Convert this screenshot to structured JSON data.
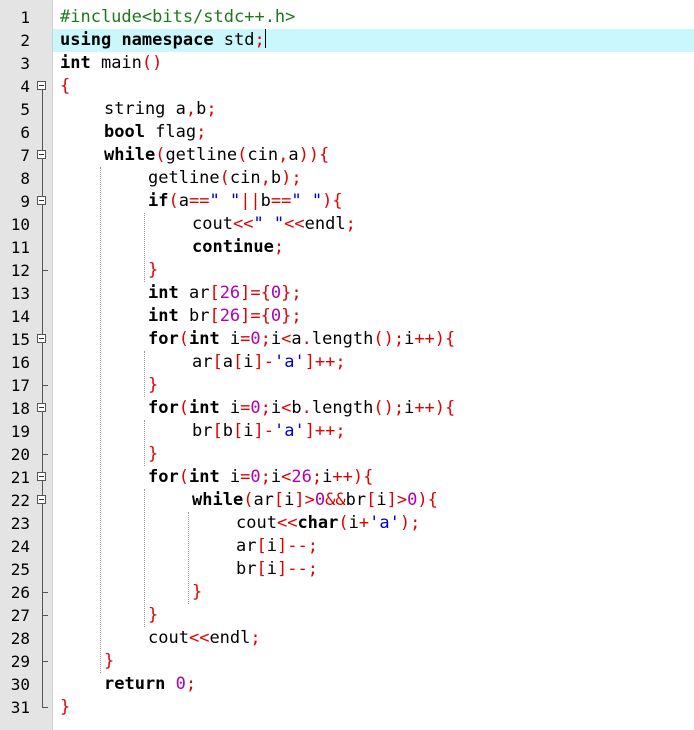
{
  "editor": {
    "current_line": 2,
    "colors": {
      "keyword": "#000000",
      "operator": "#e00000",
      "number": "#b000b0",
      "string": "#0000cc",
      "preprocessor": "#1a7a1a",
      "current_line_bg": "#c9f7fb"
    },
    "lines": [
      {
        "n": "1",
        "fold": "none",
        "indent": 0,
        "tokens": [
          [
            "pp",
            "#include<bits/stdc++.h>"
          ]
        ]
      },
      {
        "n": "2",
        "fold": "none",
        "indent": 0,
        "tokens": [
          [
            "kw",
            "using"
          ],
          [
            "txt",
            " "
          ],
          [
            "kw",
            "namespace"
          ],
          [
            "txt",
            " std"
          ],
          [
            "op",
            ";"
          ]
        ],
        "caret": true
      },
      {
        "n": "3",
        "fold": "none",
        "indent": 0,
        "tokens": [
          [
            "kw",
            "int"
          ],
          [
            "txt",
            " main"
          ],
          [
            "op",
            "()"
          ]
        ]
      },
      {
        "n": "4",
        "fold": "open",
        "indent": 0,
        "tokens": [
          [
            "op",
            "{"
          ]
        ]
      },
      {
        "n": "5",
        "fold": "line",
        "indent": 1,
        "tokens": [
          [
            "txt",
            "string a"
          ],
          [
            "op",
            ","
          ],
          [
            "txt",
            "b"
          ],
          [
            "op",
            ";"
          ]
        ]
      },
      {
        "n": "6",
        "fold": "line",
        "indent": 1,
        "tokens": [
          [
            "kw",
            "bool"
          ],
          [
            "txt",
            " flag"
          ],
          [
            "op",
            ";"
          ]
        ]
      },
      {
        "n": "7",
        "fold": "open",
        "indent": 1,
        "tokens": [
          [
            "kw",
            "while"
          ],
          [
            "op",
            "("
          ],
          [
            "txt",
            "getline"
          ],
          [
            "op",
            "("
          ],
          [
            "txt",
            "cin"
          ],
          [
            "op",
            ","
          ],
          [
            "txt",
            "a"
          ],
          [
            "op",
            "))"
          ],
          [
            "op",
            "{"
          ]
        ]
      },
      {
        "n": "8",
        "fold": "line",
        "indent": 2,
        "tokens": [
          [
            "txt",
            "getline"
          ],
          [
            "op",
            "("
          ],
          [
            "txt",
            "cin"
          ],
          [
            "op",
            ","
          ],
          [
            "txt",
            "b"
          ],
          [
            "op",
            ");"
          ]
        ]
      },
      {
        "n": "9",
        "fold": "open",
        "indent": 2,
        "tokens": [
          [
            "kw",
            "if"
          ],
          [
            "op",
            "("
          ],
          [
            "txt",
            "a"
          ],
          [
            "op",
            "=="
          ],
          [
            "str",
            "\" \""
          ],
          [
            "op",
            "||"
          ],
          [
            "txt",
            "b"
          ],
          [
            "op",
            "=="
          ],
          [
            "str",
            "\" \""
          ],
          [
            "op",
            "){"
          ]
        ]
      },
      {
        "n": "10",
        "fold": "line",
        "indent": 3,
        "tokens": [
          [
            "txt",
            "cout"
          ],
          [
            "op",
            "<<"
          ],
          [
            "str",
            "\" \""
          ],
          [
            "op",
            "<<"
          ],
          [
            "txt",
            "endl"
          ],
          [
            "op",
            ";"
          ]
        ]
      },
      {
        "n": "11",
        "fold": "line",
        "indent": 3,
        "tokens": [
          [
            "kw",
            "continue"
          ],
          [
            "op",
            ";"
          ]
        ]
      },
      {
        "n": "12",
        "fold": "end",
        "indent": 2,
        "tokens": [
          [
            "op",
            "}"
          ]
        ]
      },
      {
        "n": "13",
        "fold": "line",
        "indent": 2,
        "tokens": [
          [
            "kw",
            "int"
          ],
          [
            "txt",
            " ar"
          ],
          [
            "op",
            "["
          ],
          [
            "num",
            "26"
          ],
          [
            "op",
            "]={"
          ],
          [
            "num",
            "0"
          ],
          [
            "op",
            "};"
          ]
        ]
      },
      {
        "n": "14",
        "fold": "line",
        "indent": 2,
        "tokens": [
          [
            "kw",
            "int"
          ],
          [
            "txt",
            " br"
          ],
          [
            "op",
            "["
          ],
          [
            "num",
            "26"
          ],
          [
            "op",
            "]={"
          ],
          [
            "num",
            "0"
          ],
          [
            "op",
            "};"
          ]
        ]
      },
      {
        "n": "15",
        "fold": "open",
        "indent": 2,
        "tokens": [
          [
            "kw",
            "for"
          ],
          [
            "op",
            "("
          ],
          [
            "kw",
            "int"
          ],
          [
            "txt",
            " i"
          ],
          [
            "op",
            "="
          ],
          [
            "num",
            "0"
          ],
          [
            "op",
            ";"
          ],
          [
            "txt",
            "i"
          ],
          [
            "op",
            "<"
          ],
          [
            "txt",
            "a"
          ],
          [
            "op",
            "."
          ],
          [
            "txt",
            "length"
          ],
          [
            "op",
            "();"
          ],
          [
            "txt",
            "i"
          ],
          [
            "op",
            "++){"
          ]
        ]
      },
      {
        "n": "16",
        "fold": "line",
        "indent": 3,
        "tokens": [
          [
            "txt",
            "ar"
          ],
          [
            "op",
            "["
          ],
          [
            "txt",
            "a"
          ],
          [
            "op",
            "["
          ],
          [
            "txt",
            "i"
          ],
          [
            "op",
            "]-"
          ],
          [
            "str",
            "'a'"
          ],
          [
            "op",
            "]++;"
          ]
        ]
      },
      {
        "n": "17",
        "fold": "end",
        "indent": 2,
        "tokens": [
          [
            "op",
            "}"
          ]
        ]
      },
      {
        "n": "18",
        "fold": "open",
        "indent": 2,
        "tokens": [
          [
            "kw",
            "for"
          ],
          [
            "op",
            "("
          ],
          [
            "kw",
            "int"
          ],
          [
            "txt",
            " i"
          ],
          [
            "op",
            "="
          ],
          [
            "num",
            "0"
          ],
          [
            "op",
            ";"
          ],
          [
            "txt",
            "i"
          ],
          [
            "op",
            "<"
          ],
          [
            "txt",
            "b"
          ],
          [
            "op",
            "."
          ],
          [
            "txt",
            "length"
          ],
          [
            "op",
            "();"
          ],
          [
            "txt",
            "i"
          ],
          [
            "op",
            "++){"
          ]
        ]
      },
      {
        "n": "19",
        "fold": "line",
        "indent": 3,
        "tokens": [
          [
            "txt",
            "br"
          ],
          [
            "op",
            "["
          ],
          [
            "txt",
            "b"
          ],
          [
            "op",
            "["
          ],
          [
            "txt",
            "i"
          ],
          [
            "op",
            "]-"
          ],
          [
            "str",
            "'a'"
          ],
          [
            "op",
            "]++;"
          ]
        ]
      },
      {
        "n": "20",
        "fold": "end",
        "indent": 2,
        "tokens": [
          [
            "op",
            "}"
          ]
        ]
      },
      {
        "n": "21",
        "fold": "open",
        "indent": 2,
        "tokens": [
          [
            "kw",
            "for"
          ],
          [
            "op",
            "("
          ],
          [
            "kw",
            "int"
          ],
          [
            "txt",
            " i"
          ],
          [
            "op",
            "="
          ],
          [
            "num",
            "0"
          ],
          [
            "op",
            ";"
          ],
          [
            "txt",
            "i"
          ],
          [
            "op",
            "<"
          ],
          [
            "num",
            "26"
          ],
          [
            "op",
            ";"
          ],
          [
            "txt",
            "i"
          ],
          [
            "op",
            "++){"
          ]
        ]
      },
      {
        "n": "22",
        "fold": "open",
        "indent": 3,
        "tokens": [
          [
            "kw",
            "while"
          ],
          [
            "op",
            "("
          ],
          [
            "txt",
            "ar"
          ],
          [
            "op",
            "["
          ],
          [
            "txt",
            "i"
          ],
          [
            "op",
            "]>"
          ],
          [
            "num",
            "0"
          ],
          [
            "op",
            "&&"
          ],
          [
            "txt",
            "br"
          ],
          [
            "op",
            "["
          ],
          [
            "txt",
            "i"
          ],
          [
            "op",
            "]>"
          ],
          [
            "num",
            "0"
          ],
          [
            "op",
            "){"
          ]
        ]
      },
      {
        "n": "23",
        "fold": "line",
        "indent": 4,
        "tokens": [
          [
            "txt",
            "cout"
          ],
          [
            "op",
            "<<"
          ],
          [
            "kw",
            "char"
          ],
          [
            "op",
            "("
          ],
          [
            "txt",
            "i"
          ],
          [
            "op",
            "+"
          ],
          [
            "str",
            "'a'"
          ],
          [
            "op",
            ");"
          ]
        ]
      },
      {
        "n": "24",
        "fold": "line",
        "indent": 4,
        "tokens": [
          [
            "txt",
            "ar"
          ],
          [
            "op",
            "["
          ],
          [
            "txt",
            "i"
          ],
          [
            "op",
            "]--;"
          ]
        ]
      },
      {
        "n": "25",
        "fold": "line",
        "indent": 4,
        "tokens": [
          [
            "txt",
            "br"
          ],
          [
            "op",
            "["
          ],
          [
            "txt",
            "i"
          ],
          [
            "op",
            "]--;"
          ]
        ]
      },
      {
        "n": "26",
        "fold": "end",
        "indent": 3,
        "tokens": [
          [
            "op",
            "}"
          ]
        ]
      },
      {
        "n": "27",
        "fold": "end",
        "indent": 2,
        "tokens": [
          [
            "op",
            "}"
          ]
        ]
      },
      {
        "n": "28",
        "fold": "line",
        "indent": 2,
        "tokens": [
          [
            "txt",
            "cout"
          ],
          [
            "op",
            "<<"
          ],
          [
            "txt",
            "endl"
          ],
          [
            "op",
            ";"
          ]
        ]
      },
      {
        "n": "29",
        "fold": "end",
        "indent": 1,
        "tokens": [
          [
            "op",
            "}"
          ]
        ]
      },
      {
        "n": "30",
        "fold": "line",
        "indent": 1,
        "tokens": [
          [
            "kw",
            "return"
          ],
          [
            "txt",
            " "
          ],
          [
            "num",
            "0"
          ],
          [
            "op",
            ";"
          ]
        ]
      },
      {
        "n": "31",
        "fold": "last",
        "indent": 0,
        "tokens": [
          [
            "op",
            "}"
          ]
        ]
      }
    ]
  }
}
